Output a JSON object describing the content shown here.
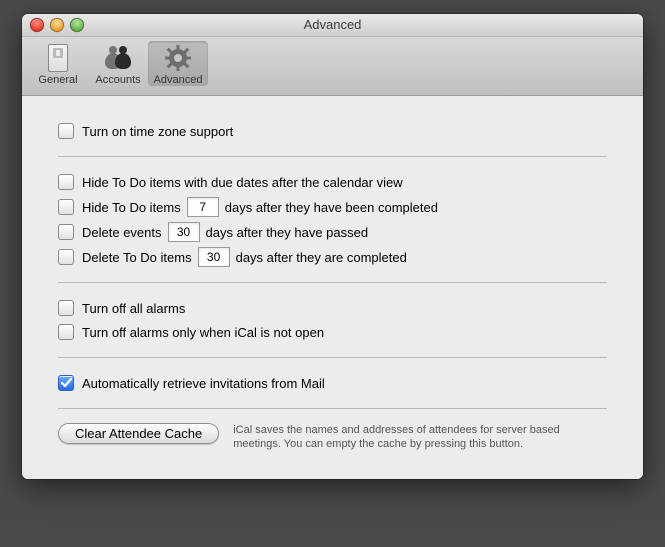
{
  "window": {
    "title": "Advanced"
  },
  "toolbar": {
    "items": [
      {
        "label": "General"
      },
      {
        "label": "Accounts"
      },
      {
        "label": "Advanced"
      }
    ]
  },
  "timezone": {
    "label": "Turn on time zone support"
  },
  "todo": {
    "hide_after_view": "Hide To Do items with due dates after the calendar view",
    "hide_completed_pre": "Hide To Do items",
    "hide_completed_days": "7",
    "hide_completed_post": "days after they have been completed",
    "delete_events_pre": "Delete events",
    "delete_events_days": "30",
    "delete_events_post": "days after they have passed",
    "delete_todo_pre": "Delete To Do items",
    "delete_todo_days": "30",
    "delete_todo_post": "days after they are completed"
  },
  "alarms": {
    "off_all": "Turn off all alarms",
    "off_not_open": "Turn off alarms only when iCal is not open"
  },
  "mail": {
    "auto_retrieve": "Automatically retrieve invitations from Mail"
  },
  "cache": {
    "button": "Clear Attendee Cache",
    "help": "iCal saves the names and addresses of attendees for server based meetings. You can empty the cache by pressing this button."
  }
}
